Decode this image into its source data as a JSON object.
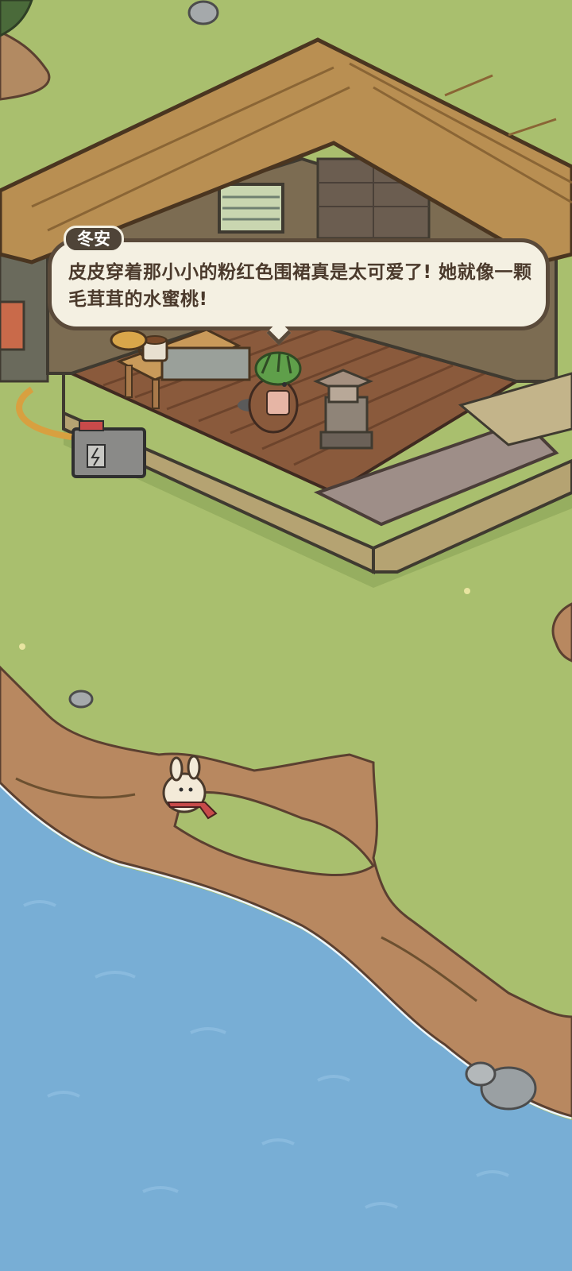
{
  "dialog": {
    "speaker": "冬安",
    "text": "皮皮穿着那小小的粉红色围裙真是太可爱了! 她就像一颗毛茸茸的水蜜桃!"
  },
  "colors": {
    "grass": "#a9bf6e",
    "sea": "#78aed5",
    "cliff": "#b88860",
    "wood_floor": "#8a5a3c",
    "roof": "#b98f52",
    "dialog_bg": "#f4f0e2",
    "dialog_border": "#5a4a3a",
    "name_tag_bg": "#4f4438"
  },
  "characters": [
    {
      "name": "beaver-with-green-hat",
      "icon": "beaver-icon"
    },
    {
      "name": "white-rabbit-with-red-scarf",
      "icon": "rabbit-icon"
    }
  ]
}
